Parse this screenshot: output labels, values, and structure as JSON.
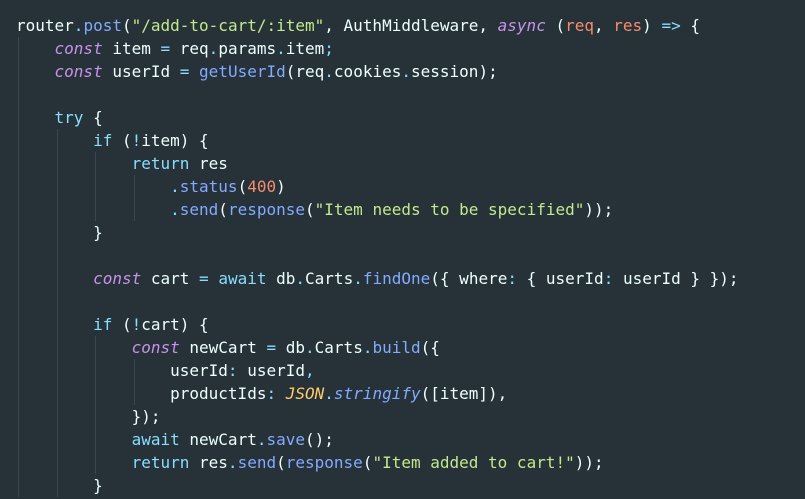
{
  "colors": {
    "background": "#263238",
    "text": "#eeffff",
    "keyword": "#c792ea",
    "control": "#89ddff",
    "function": "#82aaff",
    "string": "#c3e88d",
    "number": "#f78c6c",
    "class": "#ffcb6b"
  },
  "code": {
    "lines": [
      {
        "indent": 0,
        "tokens": [
          {
            "t": "router",
            "c": "plain"
          },
          {
            "t": ".",
            "c": "punc"
          },
          {
            "t": "post",
            "c": "fn"
          },
          {
            "t": "(",
            "c": "plain"
          },
          {
            "t": "\"/add-to-cart/:item\"",
            "c": "str"
          },
          {
            "t": ", ",
            "c": "plain"
          },
          {
            "t": "AuthMiddleware",
            "c": "plain"
          },
          {
            "t": ", ",
            "c": "plain"
          },
          {
            "t": "async",
            "c": "kw"
          },
          {
            "t": " (",
            "c": "plain"
          },
          {
            "t": "req",
            "c": "param"
          },
          {
            "t": ", ",
            "c": "plain"
          },
          {
            "t": "res",
            "c": "param"
          },
          {
            "t": ") ",
            "c": "plain"
          },
          {
            "t": "=>",
            "c": "op"
          },
          {
            "t": " {",
            "c": "plain"
          }
        ]
      },
      {
        "indent": 1,
        "tokens": [
          {
            "t": "const",
            "c": "kw"
          },
          {
            "t": " item ",
            "c": "plain"
          },
          {
            "t": "=",
            "c": "op"
          },
          {
            "t": " req",
            "c": "plain"
          },
          {
            "t": ".",
            "c": "punc"
          },
          {
            "t": "params",
            "c": "prop"
          },
          {
            "t": ".",
            "c": "punc"
          },
          {
            "t": "item",
            "c": "prop"
          },
          {
            "t": ";",
            "c": "punc"
          }
        ]
      },
      {
        "indent": 1,
        "tokens": [
          {
            "t": "const",
            "c": "kw"
          },
          {
            "t": " userId ",
            "c": "plain"
          },
          {
            "t": "=",
            "c": "op"
          },
          {
            "t": " ",
            "c": "plain"
          },
          {
            "t": "getUserId",
            "c": "fn"
          },
          {
            "t": "(req",
            "c": "plain"
          },
          {
            "t": ".",
            "c": "punc"
          },
          {
            "t": "cookies",
            "c": "prop"
          },
          {
            "t": ".",
            "c": "punc"
          },
          {
            "t": "session",
            "c": "prop"
          },
          {
            "t": ");",
            "c": "plain"
          }
        ]
      },
      {
        "indent": 0,
        "tokens": []
      },
      {
        "indent": 1,
        "tokens": [
          {
            "t": "try",
            "c": "ctrl"
          },
          {
            "t": " {",
            "c": "plain"
          }
        ]
      },
      {
        "indent": 2,
        "tokens": [
          {
            "t": "if",
            "c": "ctrl"
          },
          {
            "t": " (",
            "c": "plain"
          },
          {
            "t": "!",
            "c": "op"
          },
          {
            "t": "item) {",
            "c": "plain"
          }
        ]
      },
      {
        "indent": 3,
        "tokens": [
          {
            "t": "return",
            "c": "ctrl"
          },
          {
            "t": " res",
            "c": "plain"
          }
        ]
      },
      {
        "indent": 4,
        "tokens": [
          {
            "t": ".",
            "c": "punc"
          },
          {
            "t": "status",
            "c": "fn"
          },
          {
            "t": "(",
            "c": "plain"
          },
          {
            "t": "400",
            "c": "num"
          },
          {
            "t": ")",
            "c": "plain"
          }
        ]
      },
      {
        "indent": 4,
        "tokens": [
          {
            "t": ".",
            "c": "punc"
          },
          {
            "t": "send",
            "c": "fn"
          },
          {
            "t": "(",
            "c": "plain"
          },
          {
            "t": "response",
            "c": "fn"
          },
          {
            "t": "(",
            "c": "plain"
          },
          {
            "t": "\"Item needs to be specified\"",
            "c": "str"
          },
          {
            "t": "));",
            "c": "plain"
          }
        ]
      },
      {
        "indent": 2,
        "tokens": [
          {
            "t": "}",
            "c": "plain"
          }
        ]
      },
      {
        "indent": 0,
        "tokens": []
      },
      {
        "indent": 2,
        "tokens": [
          {
            "t": "const",
            "c": "kw"
          },
          {
            "t": " cart ",
            "c": "plain"
          },
          {
            "t": "=",
            "c": "op"
          },
          {
            "t": " ",
            "c": "plain"
          },
          {
            "t": "await",
            "c": "ctrl"
          },
          {
            "t": " db",
            "c": "plain"
          },
          {
            "t": ".",
            "c": "punc"
          },
          {
            "t": "Carts",
            "c": "prop"
          },
          {
            "t": ".",
            "c": "punc"
          },
          {
            "t": "findOne",
            "c": "fn"
          },
          {
            "t": "({ where",
            "c": "plain"
          },
          {
            "t": ":",
            "c": "punc"
          },
          {
            "t": " { userId",
            "c": "plain"
          },
          {
            "t": ":",
            "c": "punc"
          },
          {
            "t": " userId } });",
            "c": "plain"
          }
        ]
      },
      {
        "indent": 0,
        "tokens": []
      },
      {
        "indent": 2,
        "tokens": [
          {
            "t": "if",
            "c": "ctrl"
          },
          {
            "t": " (",
            "c": "plain"
          },
          {
            "t": "!",
            "c": "op"
          },
          {
            "t": "cart) {",
            "c": "plain"
          }
        ]
      },
      {
        "indent": 3,
        "tokens": [
          {
            "t": "const",
            "c": "kw"
          },
          {
            "t": " newCart ",
            "c": "plain"
          },
          {
            "t": "=",
            "c": "op"
          },
          {
            "t": " db",
            "c": "plain"
          },
          {
            "t": ".",
            "c": "punc"
          },
          {
            "t": "Carts",
            "c": "prop"
          },
          {
            "t": ".",
            "c": "punc"
          },
          {
            "t": "build",
            "c": "fn"
          },
          {
            "t": "({",
            "c": "plain"
          }
        ]
      },
      {
        "indent": 4,
        "tokens": [
          {
            "t": "userId",
            "c": "plain"
          },
          {
            "t": ":",
            "c": "punc"
          },
          {
            "t": " userId",
            "c": "plain"
          },
          {
            "t": ",",
            "c": "punc"
          }
        ]
      },
      {
        "indent": 4,
        "tokens": [
          {
            "t": "productIds",
            "c": "plain"
          },
          {
            "t": ":",
            "c": "punc"
          },
          {
            "t": " ",
            "c": "plain"
          },
          {
            "t": "JSON",
            "c": "cls"
          },
          {
            "t": ".",
            "c": "punc"
          },
          {
            "t": "stringify",
            "c": "italfn"
          },
          {
            "t": "([item]),",
            "c": "plain"
          }
        ]
      },
      {
        "indent": 3,
        "tokens": [
          {
            "t": "});",
            "c": "plain"
          }
        ]
      },
      {
        "indent": 3,
        "tokens": [
          {
            "t": "await",
            "c": "ctrl"
          },
          {
            "t": " newCart",
            "c": "plain"
          },
          {
            "t": ".",
            "c": "punc"
          },
          {
            "t": "save",
            "c": "fn"
          },
          {
            "t": "();",
            "c": "plain"
          }
        ]
      },
      {
        "indent": 3,
        "tokens": [
          {
            "t": "return",
            "c": "ctrl"
          },
          {
            "t": " res",
            "c": "plain"
          },
          {
            "t": ".",
            "c": "punc"
          },
          {
            "t": "send",
            "c": "fn"
          },
          {
            "t": "(",
            "c": "plain"
          },
          {
            "t": "response",
            "c": "fn"
          },
          {
            "t": "(",
            "c": "plain"
          },
          {
            "t": "\"Item added to cart!\"",
            "c": "str"
          },
          {
            "t": "));",
            "c": "plain"
          }
        ]
      },
      {
        "indent": 2,
        "tokens": [
          {
            "t": "}",
            "c": "plain"
          }
        ]
      }
    ]
  }
}
